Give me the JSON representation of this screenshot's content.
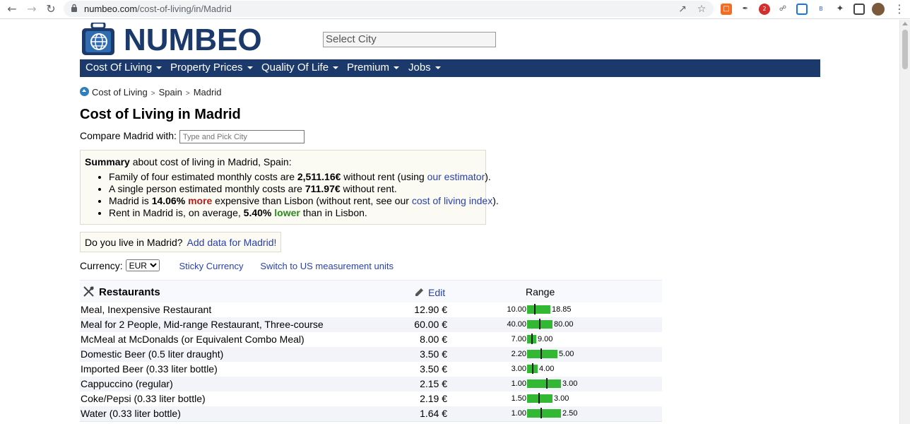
{
  "browser": {
    "url_host": "numbeo.com",
    "url_path": "/cost-of-living/in/Madrid",
    "extension_badge": "2",
    "extension_letter": "B"
  },
  "header": {
    "logo_text": "NUMBEO",
    "city_select_placeholder": "Select City",
    "menu": [
      {
        "label": "Cost Of Living"
      },
      {
        "label": "Property Prices"
      },
      {
        "label": "Quality Of Life"
      },
      {
        "label": "Premium"
      },
      {
        "label": "Jobs"
      }
    ]
  },
  "breadcrumb": {
    "items": [
      "Cost of Living",
      "Spain",
      "Madrid"
    ],
    "separator": ">"
  },
  "page": {
    "title": "Cost of Living in Madrid",
    "compare_label": "Compare Madrid with:",
    "compare_placeholder": "Type and Pick City"
  },
  "summary": {
    "heading_bold": "Summary",
    "heading_rest": " about cost of living in Madrid, Spain:",
    "line1_a": "Family of four estimated monthly costs are ",
    "line1_b": "2,511.16€",
    "line1_c": " without rent (using ",
    "line1_link": "our estimator",
    "line1_d": ").",
    "line2_a": "A single person estimated monthly costs are ",
    "line2_b": "711.97€",
    "line2_c": " without rent.",
    "line3_a": "Madrid is ",
    "line3_b": "14.06%",
    "line3_more": "more",
    "line3_c": " expensive than Lisbon (without rent, see our ",
    "line3_link": "cost of living index",
    "line3_d": ").",
    "line4_a": "Rent in Madrid is, on average, ",
    "line4_b": "5.40%",
    "line4_lower": "lower",
    "line4_c": " than in Lisbon."
  },
  "live_here": {
    "question": "Do you live in Madrid?",
    "link": "Add data for Madrid!"
  },
  "currency": {
    "label": "Currency:",
    "selected": "EUR",
    "sticky": "Sticky Currency",
    "switch_units": "Switch to US measurement units"
  },
  "table": {
    "category": "Restaurants",
    "edit_label": "Edit",
    "range_label": "Range",
    "rows": [
      {
        "name": "Meal, Inexpensive Restaurant",
        "price": "12.90 €",
        "low": "10.00",
        "high": "18.85",
        "low_v": 10.0,
        "high_v": 18.85,
        "price_v": 12.9
      },
      {
        "name": "Meal for 2 People, Mid-range Restaurant, Three-course",
        "price": "60.00 €",
        "low": "40.00",
        "high": "80.00",
        "low_v": 40.0,
        "high_v": 80.0,
        "price_v": 60.0
      },
      {
        "name": "McMeal at McDonalds (or Equivalent Combo Meal)",
        "price": "8.00 €",
        "low": "7.00",
        "high": "9.00",
        "low_v": 7.0,
        "high_v": 9.0,
        "price_v": 8.0
      },
      {
        "name": "Domestic Beer (0.5 liter draught)",
        "price": "3.50 €",
        "low": "2.20",
        "high": "5.00",
        "low_v": 2.2,
        "high_v": 5.0,
        "price_v": 3.5
      },
      {
        "name": "Imported Beer (0.33 liter bottle)",
        "price": "3.50 €",
        "low": "3.00",
        "high": "4.00",
        "low_v": 3.0,
        "high_v": 4.0,
        "price_v": 3.5
      },
      {
        "name": "Cappuccino (regular)",
        "price": "2.15 €",
        "low": "1.00",
        "high": "3.00",
        "low_v": 1.0,
        "high_v": 3.0,
        "price_v": 2.15
      },
      {
        "name": "Coke/Pepsi (0.33 liter bottle)",
        "price": "2.19 €",
        "low": "1.50",
        "high": "3.00",
        "low_v": 1.5,
        "high_v": 3.0,
        "price_v": 2.19
      },
      {
        "name": "Water (0.33 liter bottle)",
        "price": "1.64 €",
        "low": "1.00",
        "high": "2.50",
        "low_v": 1.0,
        "high_v": 2.5,
        "price_v": 1.64
      }
    ]
  },
  "colors": {
    "brand_navy": "#1b3a6b",
    "link": "#2a40ad",
    "range_bar": "#32b832",
    "more_red": "#b0201b",
    "lower_green": "#2a8a1d"
  }
}
